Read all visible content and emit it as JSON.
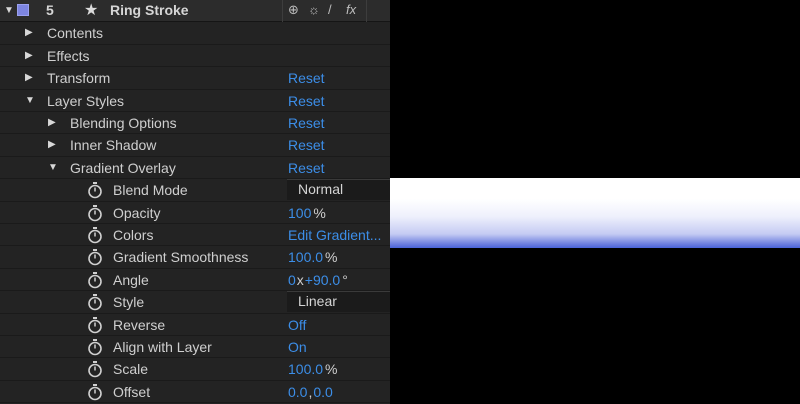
{
  "layer": {
    "number": "5",
    "name": "Ring Stroke",
    "swatch_color": "#7d85e0",
    "switches": [
      "⊕",
      "☼",
      "/",
      "fx"
    ]
  },
  "rows": {
    "contents": {
      "label": "Contents"
    },
    "effects": {
      "label": "Effects"
    },
    "transform": {
      "label": "Transform",
      "value": "Reset"
    },
    "layer_styles": {
      "label": "Layer Styles",
      "value": "Reset"
    },
    "blending_options": {
      "label": "Blending Options",
      "value": "Reset"
    },
    "inner_shadow": {
      "label": "Inner Shadow",
      "value": "Reset"
    },
    "gradient_overlay": {
      "label": "Gradient Overlay",
      "value": "Reset"
    },
    "blend_mode": {
      "label": "Blend Mode",
      "value": "Normal"
    },
    "opacity": {
      "label": "Opacity",
      "value": "100",
      "unit": "%"
    },
    "colors": {
      "label": "Colors",
      "value": "Edit Gradient..."
    },
    "gradient_smoothness": {
      "label": "Gradient Smoothness",
      "value": "100.0",
      "unit": "%"
    },
    "angle": {
      "label": "Angle",
      "rev": "0",
      "x": "x",
      "deg": "+90.0",
      "unit": "°"
    },
    "style": {
      "label": "Style",
      "value": "Linear"
    },
    "reverse": {
      "label": "Reverse",
      "value": "Off"
    },
    "align_with_layer": {
      "label": "Align with Layer",
      "value": "On"
    },
    "scale": {
      "label": "Scale",
      "value": "100.0",
      "unit": "%"
    },
    "offset": {
      "label": "Offset",
      "x": "0.0",
      "sep": ",",
      "y": "0.0"
    }
  },
  "colors": {
    "accent": "#3c8ee8",
    "panel_bg": "#232323"
  }
}
